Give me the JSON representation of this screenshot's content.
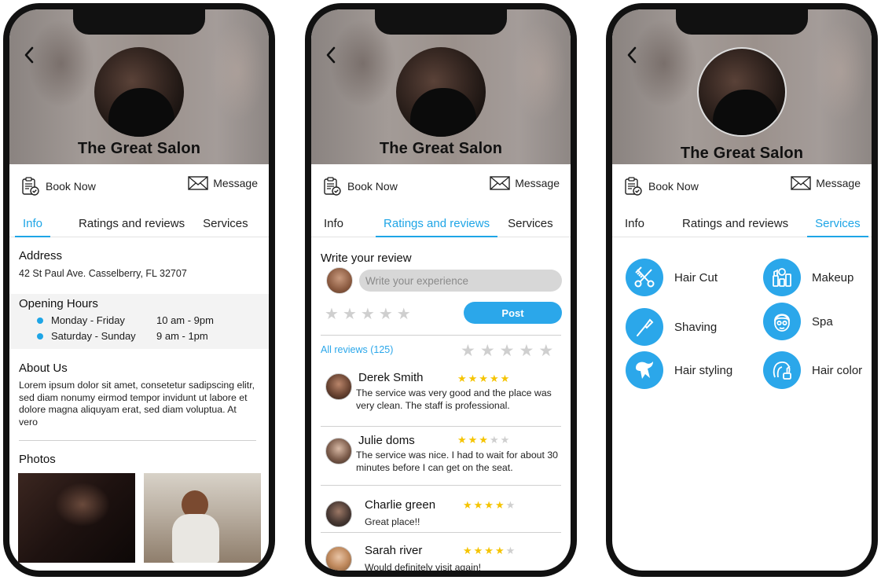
{
  "salon_name": "The Great Salon",
  "actions": {
    "book": "Book Now",
    "message": "Message"
  },
  "tabs": {
    "info": "Info",
    "ratings": "Ratings and reviews",
    "services": "Services"
  },
  "info": {
    "address_heading": "Address",
    "address": "42 St Paul Ave. Casselberry, FL 32707",
    "hours_heading": "Opening Hours",
    "hours": [
      {
        "days": "Monday - Friday",
        "time": "10 am - 9pm"
      },
      {
        "days": "Saturday - Sunday",
        "time": "9 am - 1pm"
      }
    ],
    "about_heading": "About Us",
    "about_text": "Lorem ipsum dolor sit amet, consetetur sadipscing elitr, sed diam nonumy eirmod tempor invidunt ut labore et dolore magna aliquyam erat, sed diam voluptua. At vero",
    "photos_heading": "Photos"
  },
  "reviews": {
    "write_heading": "Write your review",
    "input_placeholder": "Write your experience",
    "post_label": "Post",
    "all_reviews_label": "All reviews (125)",
    "items": [
      {
        "name": "Derek Smith",
        "rating": 5,
        "text": "The service was very good and the place was very clean. The staff is professional."
      },
      {
        "name": "Julie doms",
        "rating": 3,
        "text": "The service was nice. I had to wait for about 30 minutes before I can get on the seat."
      },
      {
        "name": "Charlie green",
        "rating": 4,
        "text": "Great place!!"
      },
      {
        "name": "Sarah river",
        "rating": 4,
        "text": "Would definitely visit again!"
      }
    ]
  },
  "services": [
    {
      "label": "Hair Cut",
      "icon": "scissors-comb-icon"
    },
    {
      "label": "Makeup",
      "icon": "makeup-icon"
    },
    {
      "label": "Shaving",
      "icon": "razor-icon"
    },
    {
      "label": "Spa",
      "icon": "spa-face-icon"
    },
    {
      "label": "Hair styling",
      "icon": "hair-styling-icon"
    },
    {
      "label": "Hair color",
      "icon": "hair-color-icon"
    }
  ],
  "colors": {
    "accent": "#1ea5e6",
    "star": "#f5c400",
    "button": "#2ba7ea"
  }
}
